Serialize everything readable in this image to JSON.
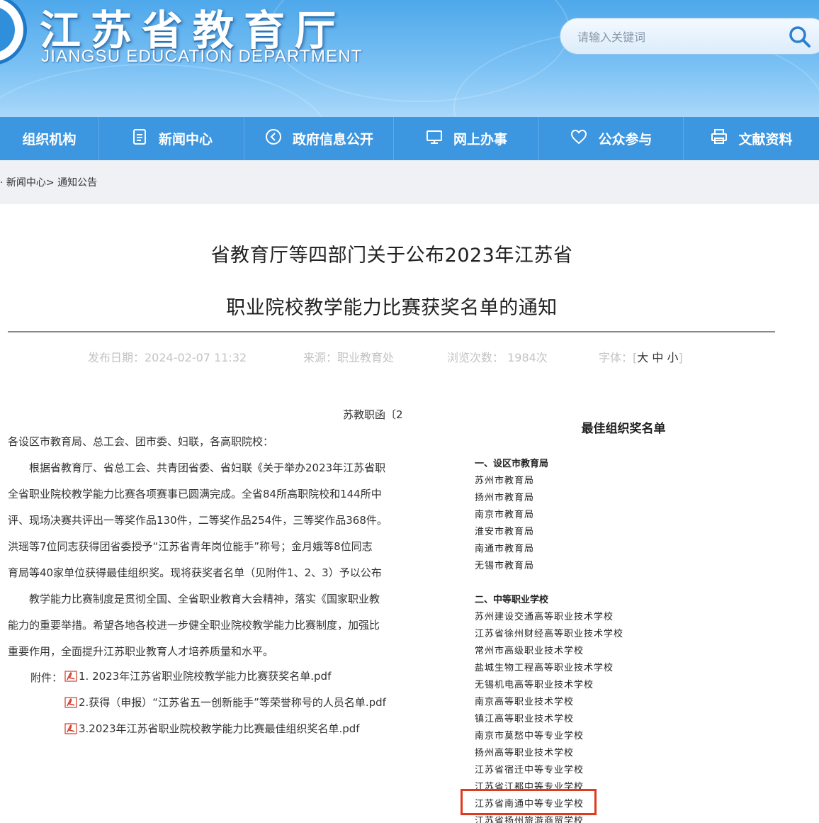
{
  "site": {
    "title_cn": "江苏省教育厅",
    "title_en": "JIANGSU EDUCATION DEPARTMENT",
    "search_placeholder": "请输入关键词"
  },
  "nav": [
    {
      "label": "组织机构",
      "icon": "none"
    },
    {
      "label": "新闻中心",
      "icon": "document-icon"
    },
    {
      "label": "政府信息公开",
      "icon": "play-circle-icon"
    },
    {
      "label": "网上办事",
      "icon": "monitor-icon"
    },
    {
      "label": "公众参与",
      "icon": "heart-icon"
    },
    {
      "label": "文献资料",
      "icon": "printer-icon"
    }
  ],
  "breadcrumb": {
    "prefix": "·",
    "item1": "新闻中心",
    "sep": ">",
    "item2": "通知公告"
  },
  "article": {
    "title_line1": "省教育厅等四部门关于公布2023年江苏省",
    "title_line2": "职业院校教学能力比赛获奖名单的通知",
    "date_label": "发布日期：2024-02-07 11:32",
    "source_label": "来源：职业教育处",
    "views_label": "浏览次数： 1984次",
    "font_label": "字体：[",
    "font_large": "大",
    "font_medium": "中",
    "font_small": "小",
    "font_close": "]",
    "doc_number": "苏教职函〔2",
    "paragraphs": [
      "各设区市教育局、总工会、团市委、妇联，各高职院校：",
      "　　根据省教育厅、省总工会、共青团省委、省妇联《关于举办2023年江苏省职",
      "全省职业院校教学能力比赛各项赛事已圆满完成。全省84所高职院校和144所中",
      "评、现场决赛共评出一等奖作品130件，二等奖作品254件，三等奖作品368件。",
      "洪瑶等7位同志获得团省委授予“江苏省青年岗位能手”称号；金月娥等8位同志",
      "育局等40家单位获得最佳组织奖。现将获奖者名单（见附件1、2、3）予以公布",
      "　　教学能力比赛制度是贯彻全国、全省职业教育大会精神，落实《国家职业教",
      "能力的重要举措。希望各地各校进一步健全职业院校教学能力比赛制度，加强比",
      "重要作用，全面提升江苏职业教育人才培养质量和水平。"
    ],
    "attachment_label": "附件：",
    "attachments": [
      "1. 2023年江苏省职业院校教学能力比赛获奖名单.pdf",
      "2.获得（申报）“江苏省五一创新能手”等荣誉称号的人员名单.pdf",
      "3.2023年江苏省职业院校教学能力比赛最佳组织奖名单.pdf"
    ]
  },
  "award_list": {
    "title": "最佳组织奖名单",
    "section1": "一、设区市教育局",
    "section1_items": [
      "苏州市教育局",
      "扬州市教育局",
      "南京市教育局",
      "淮安市教育局",
      "南通市教育局",
      "无锡市教育局"
    ],
    "section2": "二、中等职业学校",
    "section2_items": [
      "苏州建设交通高等职业技术学校",
      "江苏省徐州财经高等职业技术学校",
      "常州市高级职业技术学校",
      "盐城生物工程高等职业技术学校",
      "无锡机电高等职业技术学校",
      "南京高等职业技术学校",
      "镇江高等职业技术学校",
      "南京市莫愁中等专业学校",
      "扬州高等职业技术学校",
      "江苏省宿迁中等专业学校",
      "江苏省江都中等专业学校",
      "江苏省南通中等专业学校",
      "江苏省扬州旅游商贸学校"
    ]
  },
  "colors": {
    "header_blue": "#4ea8ea",
    "nav_blue": "#3d96e0",
    "highlight_red": "#e03a1e"
  }
}
